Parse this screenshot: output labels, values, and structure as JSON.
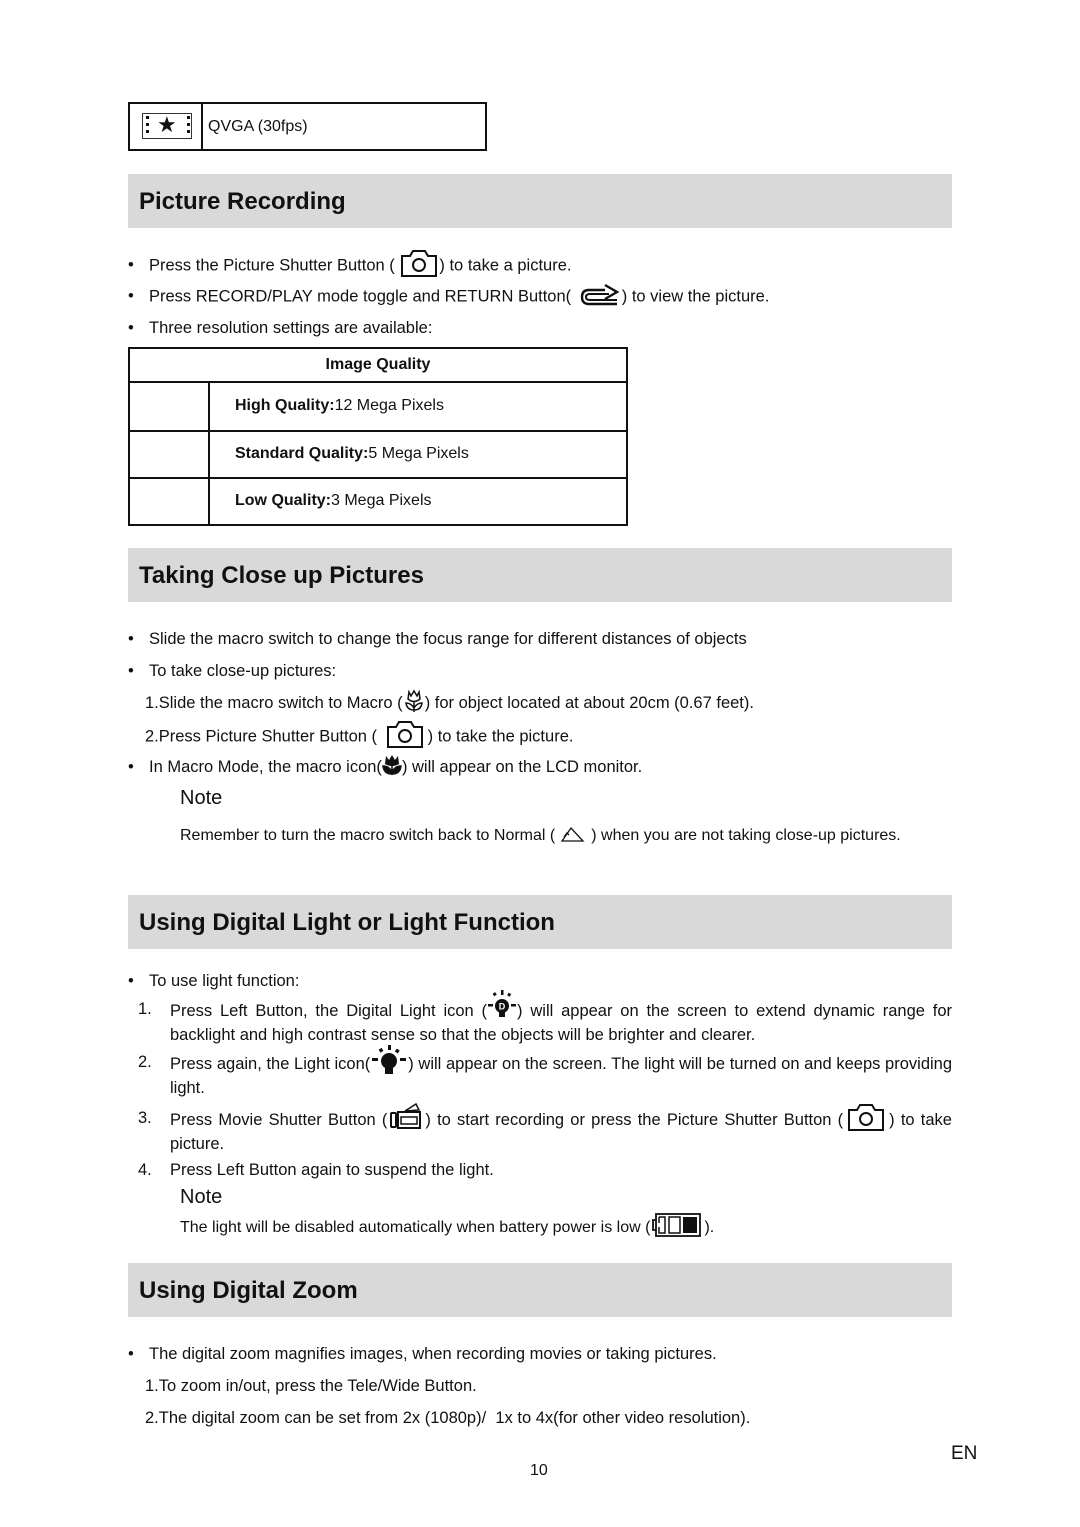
{
  "mode_table": {
    "icon": "film-star-icon",
    "label": "QVGA (30fps)"
  },
  "sections": {
    "picture_recording": {
      "title": "Picture Recording",
      "bullets": [
        {
          "before": "Press the Picture Shutter Button (",
          "icon": "camera-icon",
          "after": ") to take a picture."
        },
        {
          "before": "Press RECORD/PLAY mode toggle and RETURN Button(",
          "icon": "return-arrow-icon",
          "after": ") to view the picture."
        },
        {
          "text": "Three resolution settings are available:"
        }
      ],
      "table": {
        "header": "Image Quality",
        "rows": [
          {
            "label": "High Quality:",
            "value": "12 Mega Pixels"
          },
          {
            "label": "Standard Quality:",
            "value": "5 Mega Pixels"
          },
          {
            "label": "Low Quality:",
            "value": "3 Mega Pixels"
          }
        ]
      }
    },
    "close_up": {
      "title": "Taking Close up Pictures",
      "bullet1": "Slide the macro switch to change the focus range for different distances of objects",
      "bullet2": "To take close-up pictures:",
      "step1_before": "1.Slide the macro switch to Macro (",
      "step1_icon": "macro-tulip-outline-icon",
      "step1_after": ") for object located at about 20cm (0.67 feet).",
      "step2_before": "2.Press Picture Shutter Button (",
      "step2_icon": "camera-icon",
      "step2_after": ") to take the picture.",
      "bullet3_before": "In Macro Mode, the macro icon(",
      "bullet3_icon": "macro-tulip-filled-icon",
      "bullet3_after": ") will appear on the LCD monitor.",
      "note_heading": "Note",
      "note_before": "Remember to turn the macro switch back to Normal (",
      "note_icon": "mountain-icon",
      "note_after": ") when you are not taking close-up pictures."
    },
    "digital_light": {
      "title": "Using Digital Light or Light Function",
      "bullet": "To use light function:",
      "steps": [
        {
          "num": "1.",
          "before": "Press Left Button, the Digital Light icon (",
          "icon": "digital-light-icon",
          "after": ") will appear on the screen to extend dynamic range for backlight and high contrast sense so that the objects will be brighter and clearer."
        },
        {
          "num": "2.",
          "before": "Press again, the Light icon(",
          "icon": "light-bulb-icon",
          "after": ") will appear on the screen. The light will be turned on and keeps providing light."
        },
        {
          "num": "3.",
          "before": "Press Movie Shutter Button (",
          "icon": "movie-camera-icon",
          "middle": ") to start recording or press the Picture Shutter Button (",
          "icon2": "camera-icon",
          "after": ") to take picture."
        },
        {
          "num": "4.",
          "text": "Press Left Button again to suspend the light."
        }
      ],
      "note_heading": "Note",
      "note_before": "The light will be disabled automatically when battery power is low (",
      "note_icon": "battery-low-icon",
      "note_after": ")."
    },
    "digital_zoom": {
      "title": "Using Digital Zoom",
      "bullet": "The digital zoom magnifies images, when recording movies or taking pictures.",
      "step1": "1.To zoom in/out, press the Tele/Wide Button.",
      "step2": "2.The digital zoom can be set from 2x (1080p)/  1x to 4x(for other video resolution)."
    }
  },
  "footer": {
    "lang": "EN",
    "page_number": "10"
  }
}
